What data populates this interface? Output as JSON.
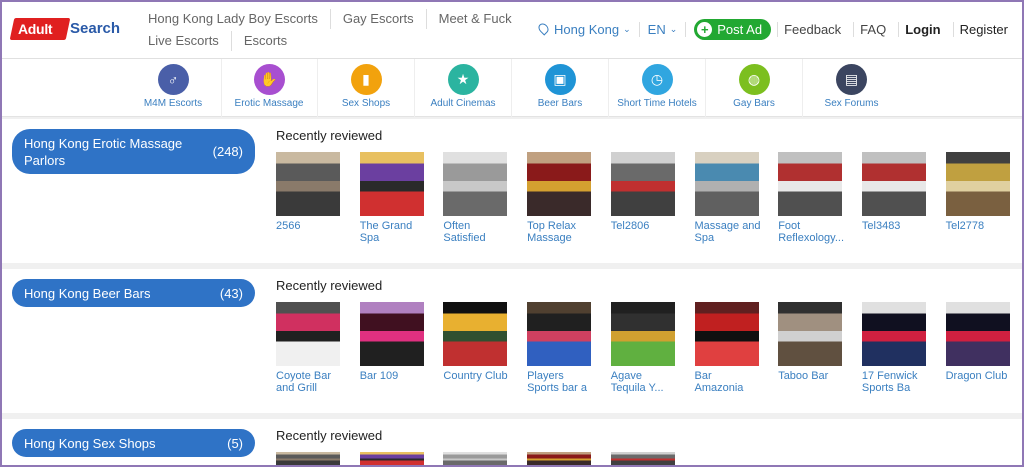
{
  "logo": {
    "brand": "Adult",
    "suffix": "Search"
  },
  "topnav": {
    "row1": [
      "Hong Kong Lady Boy Escorts",
      "Gay Escorts",
      "Meet & Fuck"
    ],
    "row2": [
      "Live Escorts",
      "Escorts"
    ]
  },
  "header_right": {
    "location": "Hong Kong",
    "language": "EN",
    "post_ad": "Post Ad",
    "feedback": "Feedback",
    "faq": "FAQ",
    "login": "Login",
    "register": "Register"
  },
  "categories": [
    {
      "label": "M4M Escorts",
      "icon": "men-icon",
      "color": "#4a5fa8",
      "glyph": "♂"
    },
    {
      "label": "Erotic Massage",
      "icon": "massage-icon",
      "color": "#a84fd0",
      "glyph": "✋"
    },
    {
      "label": "Sex Shops",
      "icon": "shop-icon",
      "color": "#f2a20d",
      "glyph": "▮"
    },
    {
      "label": "Adult Cinemas",
      "icon": "cinema-icon",
      "color": "#2bb4a0",
      "glyph": "★"
    },
    {
      "label": "Beer Bars",
      "icon": "beer-icon",
      "color": "#1f94d6",
      "glyph": "▣"
    },
    {
      "label": "Short Time Hotels",
      "icon": "clock-icon",
      "color": "#30a6e0",
      "glyph": "◷"
    },
    {
      "label": "Gay Bars",
      "icon": "globe-icon",
      "color": "#7cbf1f",
      "glyph": "◍"
    },
    {
      "label": "Sex Forums",
      "icon": "forum-icon",
      "color": "#3b4560",
      "glyph": "▤"
    }
  ],
  "sections": [
    {
      "city_button": {
        "name": "Hong Kong Erotic Massage Parlors",
        "count": "(248)"
      },
      "heading": "Recently reviewed",
      "items": [
        "2566",
        "The Grand Spa",
        "Often Satisfied",
        "Top Relax Massage",
        "Tel2806",
        "Massage and Spa",
        "Foot Reflexology...",
        "Tel3483",
        "Tel2778"
      ]
    },
    {
      "city_button": {
        "name": "Hong Kong Beer Bars",
        "count": "(43)"
      },
      "heading": "Recently reviewed",
      "items": [
        "Coyote Bar and Grill",
        "Bar 109",
        "Country Club",
        "Players Sports bar a",
        "Agave Tequila Y...",
        "Bar Amazonia",
        "Taboo Bar",
        "17 Fenwick Sports Ba",
        "Dragon Club"
      ]
    },
    {
      "city_button": {
        "name": "Hong Kong Sex Shops",
        "count": "(5)"
      },
      "heading": "Recently reviewed",
      "items": [
        "",
        "",
        "",
        "",
        ""
      ]
    }
  ],
  "colors": {
    "accent": "#2f73c6",
    "link": "#3a7fc0",
    "post_ad": "#22a832",
    "logo_red": "#e02020"
  }
}
